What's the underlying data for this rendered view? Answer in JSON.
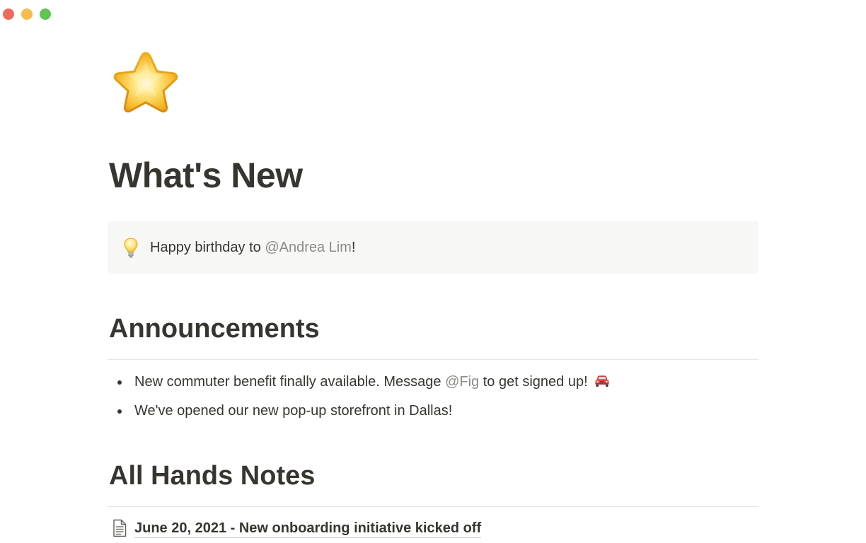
{
  "window": {
    "controls": [
      "close",
      "minimize",
      "maximize"
    ]
  },
  "page": {
    "icon": "star-icon",
    "title": "What's New"
  },
  "callout": {
    "icon": "lightbulb-icon",
    "text_before": "Happy birthday to ",
    "mention": "@Andrea Lim",
    "text_after": "!"
  },
  "announcements": {
    "heading": "Announcements",
    "items": [
      {
        "text_before": "New commuter benefit finally available. Message ",
        "mention": "@Fig",
        "text_after": " to get signed up! ",
        "icon": "car-icon"
      },
      {
        "text": "We've opened our new pop-up storefront in Dallas!"
      }
    ]
  },
  "all_hands": {
    "heading": "All Hands Notes",
    "pages": [
      {
        "icon": "document-icon",
        "title": "June 20, 2021 - New onboarding initiative kicked off"
      }
    ]
  },
  "colors": {
    "text": "#37352f",
    "mention": "#8c8b88",
    "callout_bg": "#f7f7f5",
    "divider": "#e6e6e3",
    "close": "#ee6a5f",
    "minimize": "#f5bd4f",
    "maximize": "#61c454"
  }
}
